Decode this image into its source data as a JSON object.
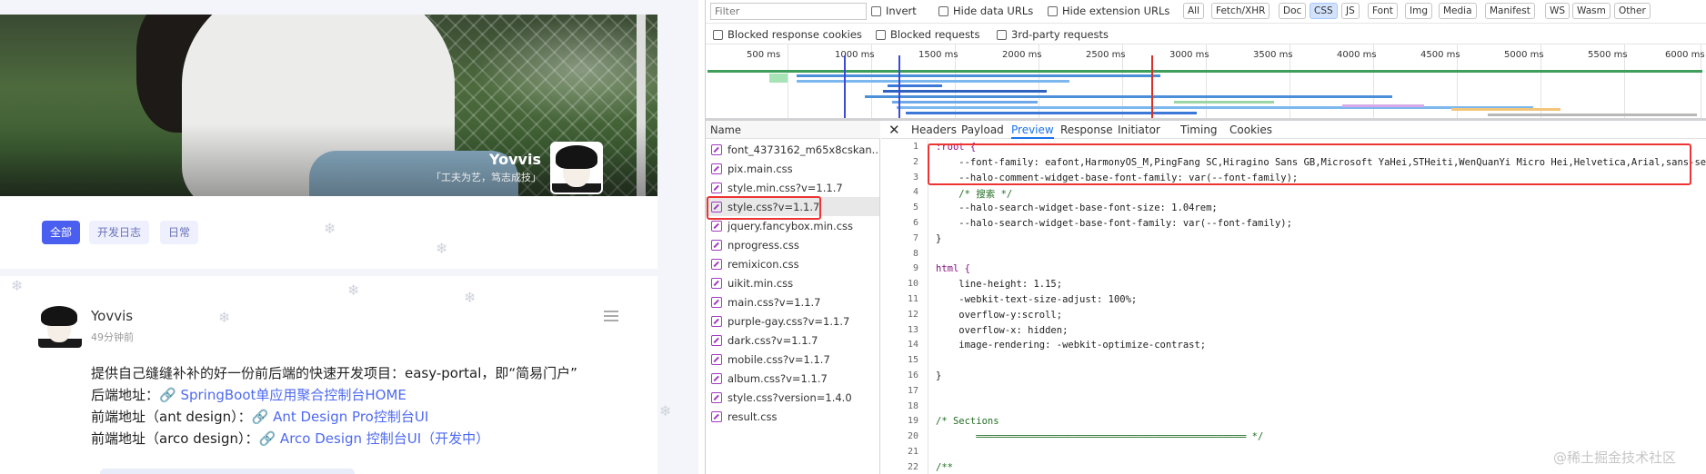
{
  "blog": {
    "author_name": "Yovvis",
    "author_motto": "「工夫为艺，笃志成技」",
    "tags": [
      "全部",
      "开发日志",
      "日常"
    ],
    "post": {
      "author": "Yovvis",
      "time": "49分钟前",
      "line1": "提供自己缝缝补补的好一份前后端的快速开发项目：easy-portal，即“简易门户”",
      "backend_label": "后端地址：",
      "backend_link": "🔗 SpringBoot单应用聚合控制台HOME",
      "front1_label": "前端地址（ant design）：",
      "front1_link": "🔗 Ant Design Pro控制台UI",
      "front2_label": "前端地址（arco design）：",
      "front2_link": "🔗 Arco Design 控制台UI（开发中）"
    }
  },
  "devtools": {
    "filter_placeholder": "Filter",
    "checkboxes_row1": [
      "Invert",
      "Hide data URLs",
      "Hide extension URLs"
    ],
    "type_filters": [
      "All",
      "Fetch/XHR",
      "Doc",
      "CSS",
      "JS",
      "Font",
      "Img",
      "Media",
      "Manifest",
      "WS",
      "Wasm",
      "Other"
    ],
    "active_filter": "CSS",
    "checkboxes_row2": [
      "Blocked response cookies",
      "Blocked requests",
      "3rd-party requests"
    ],
    "timeline_ticks": [
      "500 ms",
      "1000 ms",
      "1500 ms",
      "2000 ms",
      "2500 ms",
      "3000 ms",
      "3500 ms",
      "4000 ms",
      "4500 ms",
      "5000 ms",
      "5500 ms",
      "6000 ms"
    ],
    "name_header": "Name",
    "files": [
      "font_4373162_m65x8cskan...",
      "pix.main.css",
      "style.min.css?v=1.1.7",
      "style.css?v=1.1.7",
      "jquery.fancybox.min.css",
      "nprogress.css",
      "remixicon.css",
      "uikit.min.css",
      "main.css?v=1.1.7",
      "purple-gay.css?v=1.1.7",
      "dark.css?v=1.1.7",
      "mobile.css?v=1.1.7",
      "album.css?v=1.1.7",
      "style.css?version=1.4.0",
      "result.css"
    ],
    "selected_file": "style.css?v=1.1.7",
    "preview_tabs": [
      "Headers",
      "Payload",
      "Preview",
      "Response",
      "Initiator",
      "Timing",
      "Cookies"
    ],
    "active_tab": "Preview",
    "code_lines": [
      {
        "n": "1",
        "t": ":root {"
      },
      {
        "n": "2",
        "t": "    --font-family: eafont,HarmonyOS_M,PingFang SC,Hiragino Sans GB,Microsoft YaHei,STHeiti,WenQuanYi Micro Hei,Helvetica,Arial,sans-serif;"
      },
      {
        "n": "3",
        "t": "    --halo-comment-widget-base-font-family: var(--font-family);"
      },
      {
        "n": "4",
        "t": "    /* 搜索 */"
      },
      {
        "n": "5",
        "t": "    --halo-search-widget-base-font-size: 1.04rem;"
      },
      {
        "n": "6",
        "t": "    --halo-search-widget-base-font-family: var(--font-family);"
      },
      {
        "n": "7",
        "t": "}"
      },
      {
        "n": "8",
        "t": ""
      },
      {
        "n": "9",
        "t": "html {"
      },
      {
        "n": "10",
        "t": "    line-height: 1.15;"
      },
      {
        "n": "11",
        "t": "    -webkit-text-size-adjust: 100%;"
      },
      {
        "n": "12",
        "t": "    overflow-y:scroll;"
      },
      {
        "n": "13",
        "t": "    overflow-x: hidden;"
      },
      {
        "n": "14",
        "t": "    image-rendering: -webkit-optimize-contrast;"
      },
      {
        "n": "15",
        "t": ""
      },
      {
        "n": "16",
        "t": "}"
      },
      {
        "n": "17",
        "t": ""
      },
      {
        "n": "18",
        "t": ""
      },
      {
        "n": "19",
        "t": "/* Sections"
      },
      {
        "n": "20",
        "t": "       ═══════════════════════════════════════════════ */"
      },
      {
        "n": "21",
        "t": ""
      },
      {
        "n": "22",
        "t": "/**"
      }
    ]
  },
  "watermark": "@稀土掘金技术社区",
  "colors": {
    "accent": "#4a5ef0",
    "link": "#4e6af0",
    "devtools_active": "#1a73e8",
    "highlight": "#e33333"
  }
}
